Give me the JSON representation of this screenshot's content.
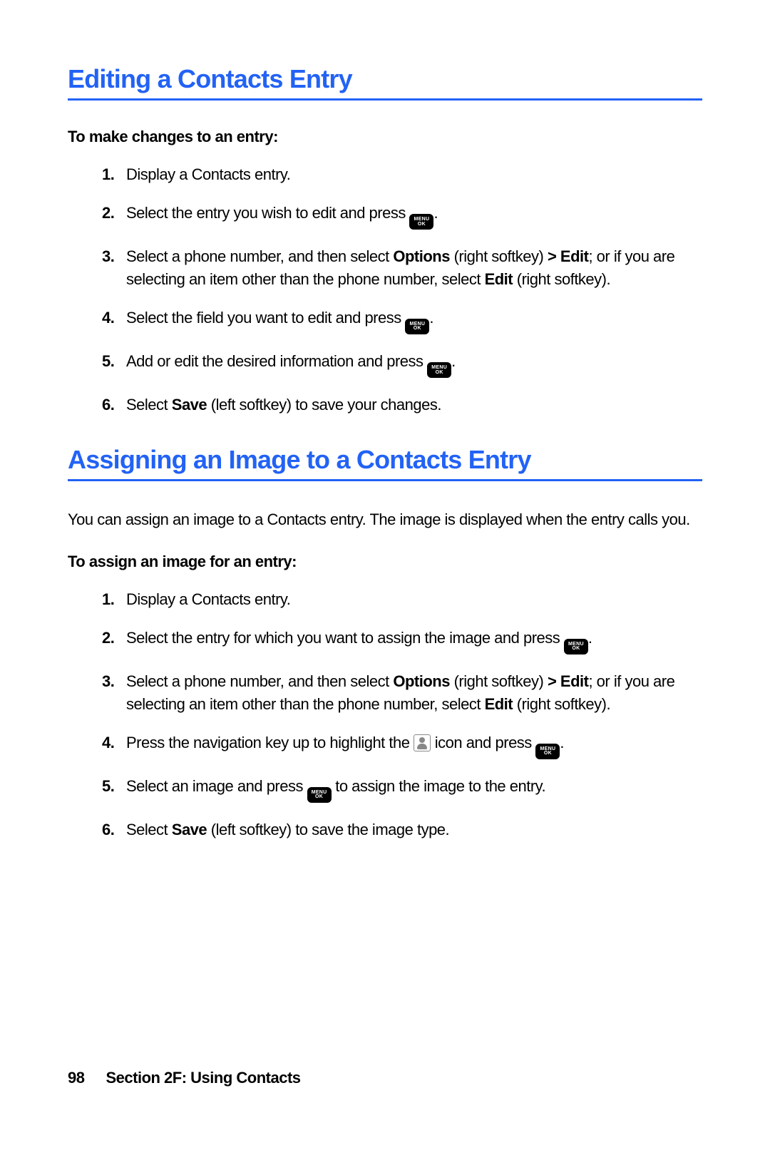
{
  "section1": {
    "heading": "Editing a Contacts Entry",
    "subhead": "To make changes to an entry:",
    "steps": {
      "s1": "Display a Contacts entry.",
      "s2a": "Select the entry you wish to edit and press ",
      "s2b": ".",
      "s3a": "Select a phone number, and then select ",
      "s3b": "Options",
      "s3c": " (right softkey) ",
      "s3d": "> Edit",
      "s3e": "; or if you are selecting an item other than the phone number, select ",
      "s3f": "Edit",
      "s3g": " (right softkey).",
      "s4a": "Select the field you want to edit and press ",
      "s4b": ".",
      "s5a": "Add or edit the desired information and press ",
      "s5b": ".",
      "s6a": "Select ",
      "s6b": "Save",
      "s6c": " (left softkey) to save your changes."
    }
  },
  "section2": {
    "heading": "Assigning an Image to a Contacts Entry",
    "intro": "You can assign an image to a Contacts entry. The image is displayed when the entry calls you.",
    "subhead": "To assign an image for an entry:",
    "steps": {
      "s1": "Display a Contacts entry.",
      "s2a": "Select the entry for which you want to assign the image and press ",
      "s2b": ".",
      "s3a": "Select a phone number, and then select ",
      "s3b": "Options",
      "s3c": " (right softkey) ",
      "s3d": "> Edit",
      "s3e": "; or if you are selecting an item other than the phone number, select ",
      "s3f": "Edit",
      "s3g": " (right softkey).",
      "s4a": "Press the navigation key up to highlight the ",
      "s4b": " icon and press ",
      "s4c": ".",
      "s5a": "Select an image and press ",
      "s5b": " to assign the image to the entry.",
      "s6a": "Select ",
      "s6b": "Save",
      "s6c": " (left softkey) to save the image type."
    }
  },
  "footer": {
    "page": "98",
    "section": "Section 2F: Using Contacts"
  },
  "icon": {
    "menu": "MENU",
    "ok": "OK"
  }
}
